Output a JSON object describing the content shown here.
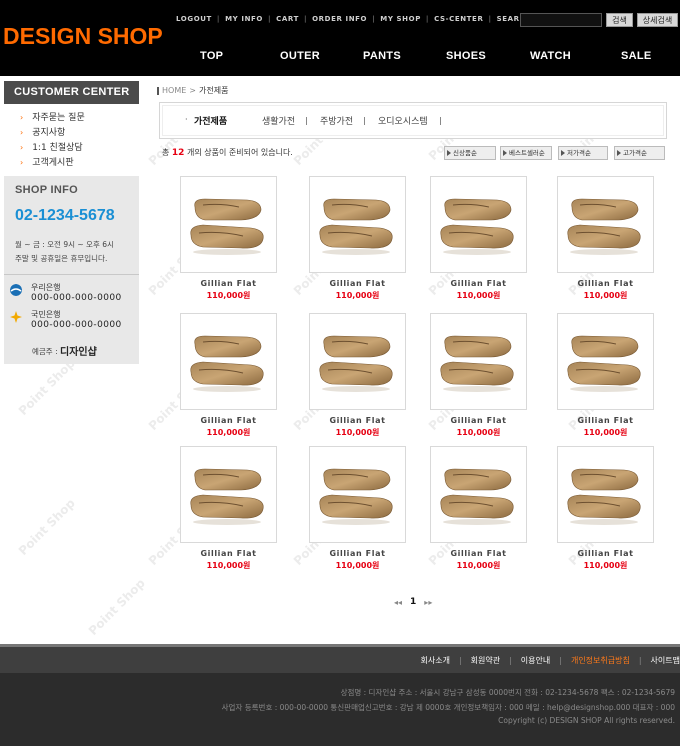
{
  "header": {
    "logo": "DESIGN SHOP",
    "top_links": [
      "LOGOUT",
      "MY INFO",
      "CART",
      "ORDER INFO",
      "MY SHOP",
      "CS-CENTER",
      "SEARCH"
    ],
    "search_placeholder": "",
    "search_button": "검색",
    "detail_search_button": "상세검색",
    "main_nav": [
      "TOP",
      "OUTER",
      "PANTS",
      "SHOES",
      "WATCH",
      "SALE"
    ]
  },
  "sidebar": {
    "customer_center_title": "CUSTOMER CENTER",
    "cc_items": [
      "자주묻는 질문",
      "공지사항",
      "1:1 친절상담",
      "고객게시판"
    ],
    "shop_info_title": "SHOP INFO",
    "phone": "02-1234-5678",
    "hours_line1": "월 ~ 금 : 오전 9시 ~ 오후 6시",
    "hours_line2": "주말 및 공휴일은 휴무입니다.",
    "banks": [
      {
        "name": "우리은행",
        "account": "000-000-000-0000",
        "icon": "woori-bank-icon",
        "color": "#1a6fb5"
      },
      {
        "name": "국민은행",
        "account": "000-000-000-0000",
        "icon": "kb-bank-icon",
        "color": "#f2a900"
      }
    ],
    "holder_label": "예금주 :",
    "holder_value": "디자인샵"
  },
  "main": {
    "breadcrumb_home": "HOME",
    "breadcrumb_sep": ">",
    "breadcrumb_current": "가전제품",
    "category_active": "가전제품",
    "category_subs": [
      "생활가전",
      "주방가전",
      "오디오시스템"
    ],
    "count_prefix": "총",
    "count": "12",
    "count_suffix": "개의 상품이 준비되어 있습니다.",
    "sort_buttons": [
      "신상품순",
      "베스트셀러순",
      "저가격순",
      "고가격순"
    ],
    "products": [
      {
        "name": "Gillian Flat",
        "price": "110,000원"
      },
      {
        "name": "Gillian Flat",
        "price": "110,000원"
      },
      {
        "name": "Gillian Flat",
        "price": "110,000원"
      },
      {
        "name": "Gillian Flat",
        "price": "110,000원"
      },
      {
        "name": "Gillian Flat",
        "price": "110,000원"
      },
      {
        "name": "Gillian Flat",
        "price": "110,000원"
      },
      {
        "name": "Gillian Flat",
        "price": "110,000원"
      },
      {
        "name": "Gillian Flat",
        "price": "110,000원"
      },
      {
        "name": "Gillian Flat",
        "price": "110,000원"
      },
      {
        "name": "Gillian Flat",
        "price": "110,000원"
      },
      {
        "name": "Gillian Flat",
        "price": "110,000원"
      },
      {
        "name": "Gillian Flat",
        "price": "110,000원"
      }
    ],
    "pager_prev": "◂◂",
    "pager_current": "1",
    "pager_next": "▸▸"
  },
  "footer": {
    "links": [
      "회사소개",
      "회원약관",
      "이용안내",
      "개인정보취급방침",
      "사이트맵"
    ],
    "highlight_link_index": 3,
    "line1": "상점명 : 디자인샵  주소 : 서울시 강남구 삼성동 0000번지  전화 : 02-1234-5678  팩스 : 02-1234-5679",
    "line2": "사업자 등록번호 : 000-00-0000  통신판매업신고번호 : 강남 제 0000호 개인정보책임자 : 000  메일 : help@designshop.000  대표자 : 000",
    "copyright": "Copyright (c) DESIGN SHOP All rights reserved."
  },
  "watermark": "Point Shop",
  "colors": {
    "brand_orange": "#ff6a00",
    "phone_blue": "#1a8fd4",
    "price_red": "#e60012"
  }
}
